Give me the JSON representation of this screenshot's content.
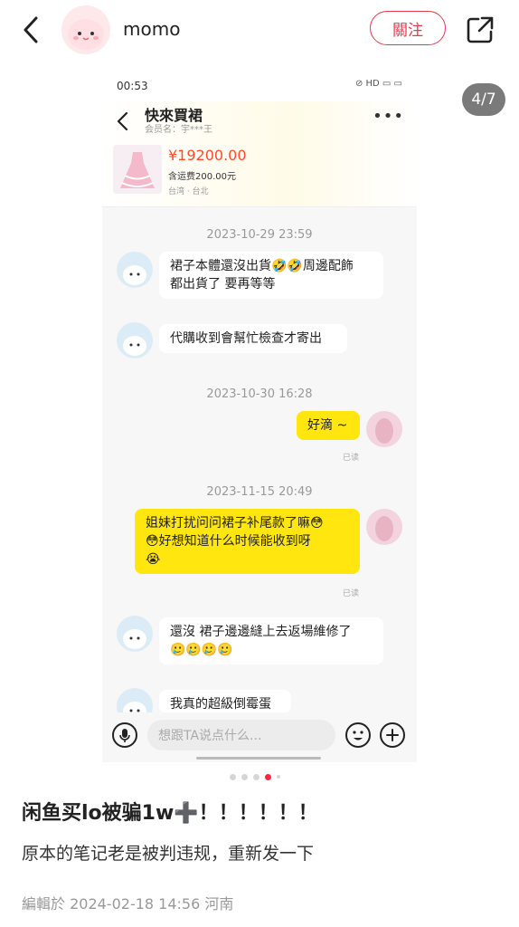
{
  "header": {
    "username": "momo",
    "follow_label": "關注",
    "icons": [
      "back-icon",
      "share-icon"
    ]
  },
  "gallery": {
    "counter": "4/7",
    "page_total": 7,
    "current_page": 4
  },
  "screenshot": {
    "status_time": "00:53",
    "status_icons": "⊘ HD ▭ ▭",
    "chat_title": "快來買裙",
    "chat_subtitle": "会员名：宇***王",
    "more": "•••",
    "item": {
      "price": "¥19200.00",
      "shipping": "含运费200.00元",
      "location": "台湾 · 台北"
    },
    "messages": [
      {
        "type": "timestamp",
        "text": "2023-10-29 23:59"
      },
      {
        "type": "seller",
        "lines": [
          "裙子本體還沒出貨🤣🤣周邊配飾",
          "都出貨了 要再等等"
        ]
      },
      {
        "type": "seller",
        "lines": [
          "代購收到會幫忙檢查才寄出"
        ]
      },
      {
        "type": "timestamp",
        "text": "2023-10-30 16:28"
      },
      {
        "type": "me",
        "lines": [
          "好滴 ~"
        ],
        "status": "已读"
      },
      {
        "type": "timestamp",
        "text": "2023-11-15 20:49"
      },
      {
        "type": "me",
        "lines": [
          "姐妹打扰问问裙子补尾款了嘛😳",
          "😳好想知道什么时候能收到呀",
          "😭"
        ],
        "status": "已读"
      },
      {
        "type": "seller",
        "lines": [
          "還沒 裙子邊邊縫上去返場維修了",
          "🥲🥲🥲🥲"
        ]
      },
      {
        "type": "seller",
        "lines": [
          "我真的超級倒霉蛋"
        ]
      }
    ],
    "input_placeholder": "想跟TA说点什么..."
  },
  "post": {
    "title": "闲鱼买lo被骗1w➕！！！！！！",
    "body": "原本的笔记老是被判违规，重新发一下",
    "meta": "編輯於 2024-02-18 14:56 河南"
  },
  "colors": {
    "accent": "#e8394b",
    "price": "#ff4b2b",
    "my_bubble": "#ffe60f",
    "active_dot": "#ff2442"
  }
}
